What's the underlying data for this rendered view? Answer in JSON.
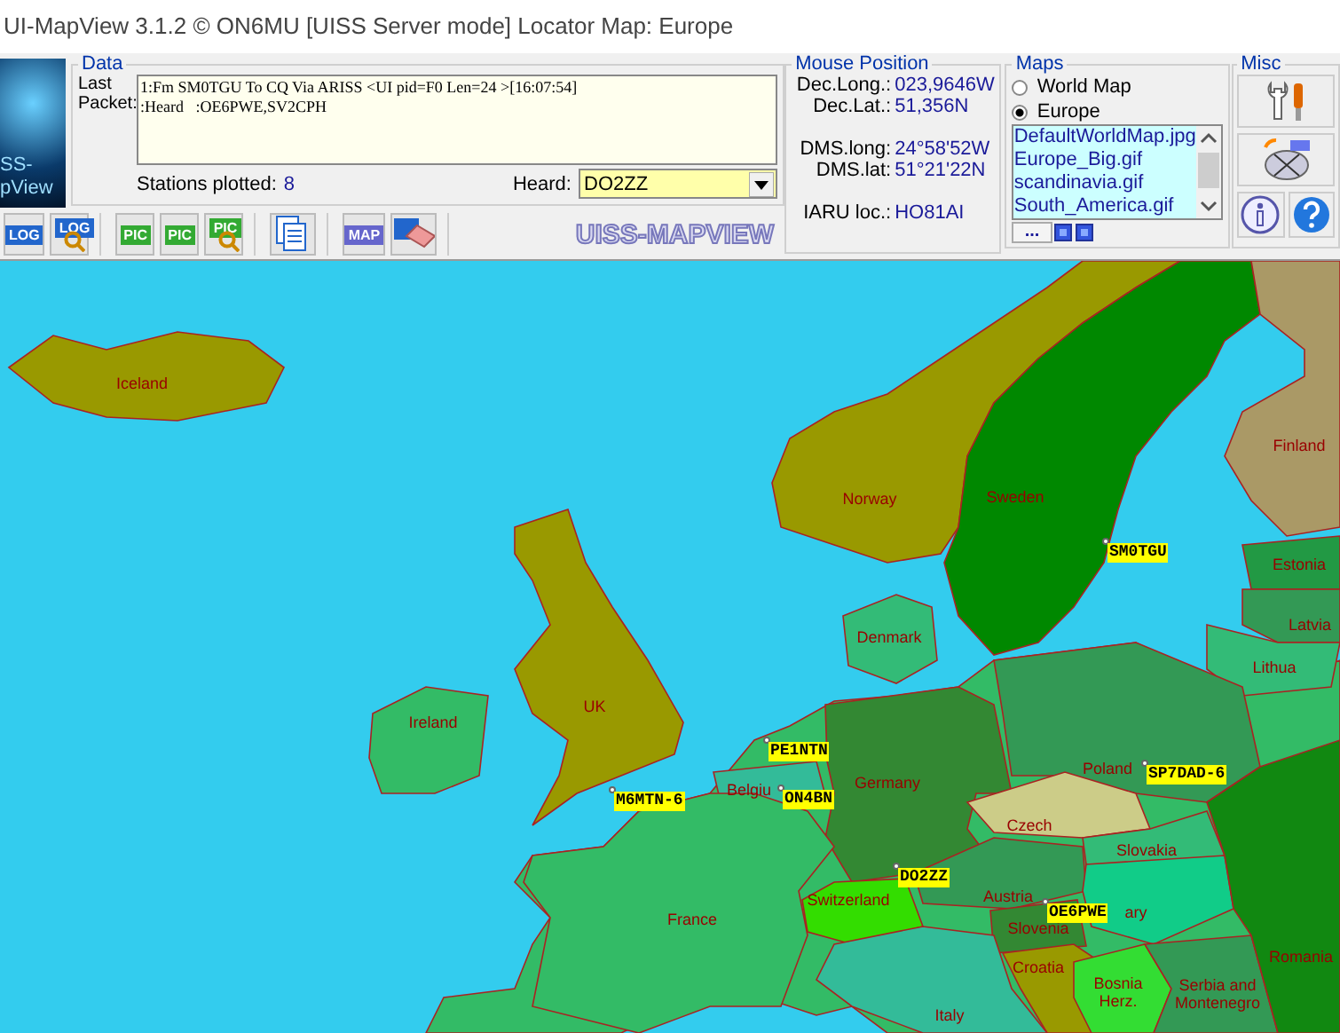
{
  "window": {
    "title": "UI-MapView 3.1.2 © ON6MU  [UISS Server mode]  Locator Map: Europe"
  },
  "logo": {
    "lines": [
      "SS-",
      "pView"
    ]
  },
  "data": {
    "legend": "Data",
    "packet_label": "Last Packet:",
    "packet_lines": [
      "1:Fm SM0TGU To CQ Via ARISS <UI pid=F0 Len=24 >[16:07:54]",
      ":Heard   :OE6PWE,SV2CPH"
    ],
    "stations_label": "Stations plotted:",
    "stations_value": "8",
    "heard_label": "Heard:",
    "heard_value": "DO2ZZ"
  },
  "toolbar_groups": [
    [
      {
        "kind": "log-save",
        "label": "LOG"
      },
      {
        "kind": "log-search",
        "label": "LOG"
      }
    ],
    [
      {
        "kind": "pic-open",
        "label": "PIC"
      },
      {
        "kind": "pic-save",
        "label": "PIC"
      },
      {
        "kind": "pic-search",
        "label": "PIC"
      }
    ],
    [
      {
        "kind": "document"
      }
    ],
    [
      {
        "kind": "map",
        "label": "MAP"
      },
      {
        "kind": "eraser"
      }
    ]
  ],
  "banner": "UISS-MAPVIEW",
  "mouse_position": {
    "legend": "Mouse Position",
    "rows": [
      {
        "label": "Dec.Long.:",
        "value": "023,9646W"
      },
      {
        "label": "Dec.Lat.:",
        "value": "51,356N"
      },
      {
        "label": "DMS.long:",
        "value": "24°58'52W"
      },
      {
        "label": "DMS.lat:",
        "value": "51°21'22N"
      },
      {
        "label": "IARU loc.:",
        "value": "HO81AI"
      }
    ]
  },
  "maps": {
    "legend": "Maps",
    "options": [
      {
        "label": "World Map",
        "selected": false
      },
      {
        "label": "Europe",
        "selected": true
      }
    ],
    "files": [
      "DefaultWorldMap.jpg",
      "Europe_Big.gif",
      "scandinavia.gif",
      "South_America.gif"
    ],
    "more_button": "..."
  },
  "misc": {
    "legend": "Misc"
  },
  "map": {
    "countries": [
      {
        "name": "Iceland",
        "color": "#999900"
      },
      {
        "name": "Norway",
        "color": "#999900"
      },
      {
        "name": "Sweden",
        "color": "#008800"
      },
      {
        "name": "Finland",
        "color": "#aa9966"
      },
      {
        "name": "Estonia",
        "color": "#229944"
      },
      {
        "name": "Latvia",
        "color": "#339955"
      },
      {
        "name": "Lithua",
        "color": "#33bb77"
      },
      {
        "name": "Denmark",
        "color": "#33bb77"
      },
      {
        "name": "UK",
        "color": "#999900"
      },
      {
        "name": "Ireland",
        "color": "#33bb66"
      },
      {
        "name": "Germany",
        "color": "#338833"
      },
      {
        "name": "Belgiu",
        "color": "#33bb99"
      },
      {
        "name": "Poland",
        "color": "#339955"
      },
      {
        "name": "Czech",
        "color": "#cccc88"
      },
      {
        "name": "Slovakia",
        "color": "#33bb77"
      },
      {
        "name": "France",
        "color": "#33bb66"
      },
      {
        "name": "Switzerland",
        "color": "#33dd00"
      },
      {
        "name": "Austria",
        "color": "#339955"
      },
      {
        "name": "ary",
        "color": "#11cc88"
      },
      {
        "name": "Slovenia",
        "color": "#338833"
      },
      {
        "name": "Croatia",
        "color": "#999900"
      },
      {
        "name": "Bosnia Herz.",
        "color": "#33dd33"
      },
      {
        "name": "Serbia and Montenegro",
        "color": "#339955"
      },
      {
        "name": "Italy",
        "color": "#33bb99"
      },
      {
        "name": "Romania",
        "color": "#118811"
      }
    ],
    "stations": [
      {
        "call": "SM0TGU"
      },
      {
        "call": "SP7DAD-6"
      },
      {
        "call": "PE1NTN"
      },
      {
        "call": "ON4BN"
      },
      {
        "call": "M6MTN-6"
      },
      {
        "call": "DO2ZZ"
      },
      {
        "call": "OE6PWE"
      }
    ]
  }
}
